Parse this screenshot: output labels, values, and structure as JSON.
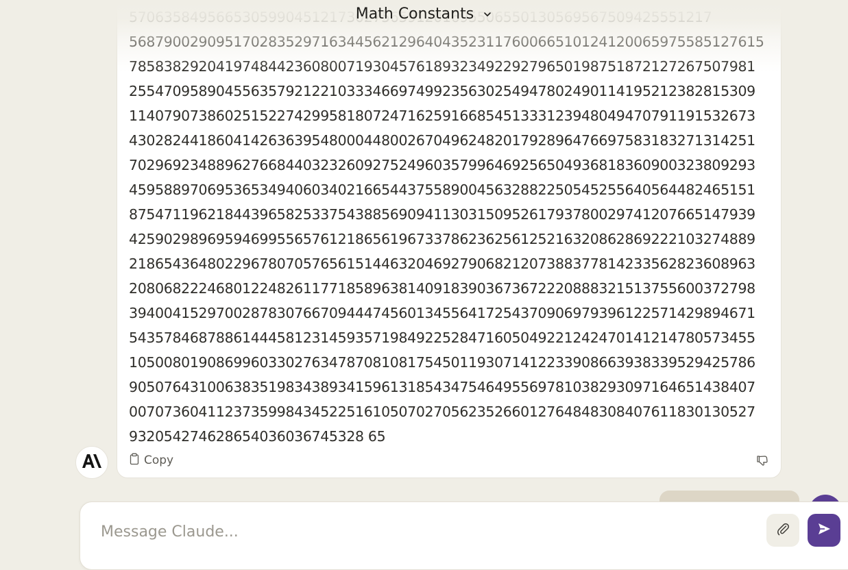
{
  "header": {
    "title": "Math Constants"
  },
  "message": {
    "lines": [
      "5706358495665305990451217302756591201695506550130569567509425551217",
      "5687900290951702835297163445621296404352311760066510124120065975585127615",
      "785838292041974844236080071930457618932349229279650198751872127267507981",
      "255470958904556357921221033346697499235630254947802490114195212382815309",
      "114079073860251522742995818072471625916685451333123948049470791191532673",
      "430282441860414263639548000448002670496248201792896476697583183271314251",
      "702969234889627668440323260927524960357996469256504936818360900323809293",
      "459588970695365349406034021665443755890045632882250545255640564482465151",
      "875471196218443965825337543885690941130315095261793780029741207665147939",
      "425902989695946995565761218656196733786236256125216320862869222103274889",
      "218654364802296780705765615144632046927906821207388377814233562823608963",
      "208068222468012248261177185896381409183903673672220888321513755600372798",
      "394004152970028783076670944474560134556417254370906979396122571429894671",
      "543578468788614445812314593571984922528471605049221242470141214780573455",
      "105008019086996033027634787081081754501193071412233908663938339529425786",
      "905076431006383519834389341596131854347546495569781038293097164651438407",
      "007073604112373599843452251610507027056235266012764848308407611830130527",
      "932054274628654036036745328 65"
    ],
    "copy_label": "Copy"
  },
  "composer": {
    "placeholder": "Message Claude..."
  },
  "icons": {
    "send": "send-icon",
    "attach": "paperclip-icon",
    "copy": "clipboard-icon",
    "dislike": "thumbs-down-icon",
    "logo": "anthropic-logo",
    "chevron": "chevron-down-icon"
  },
  "colors": {
    "accent": "#5a3e94",
    "background": "#f0eee6",
    "bubble": "#ddd6c6"
  }
}
